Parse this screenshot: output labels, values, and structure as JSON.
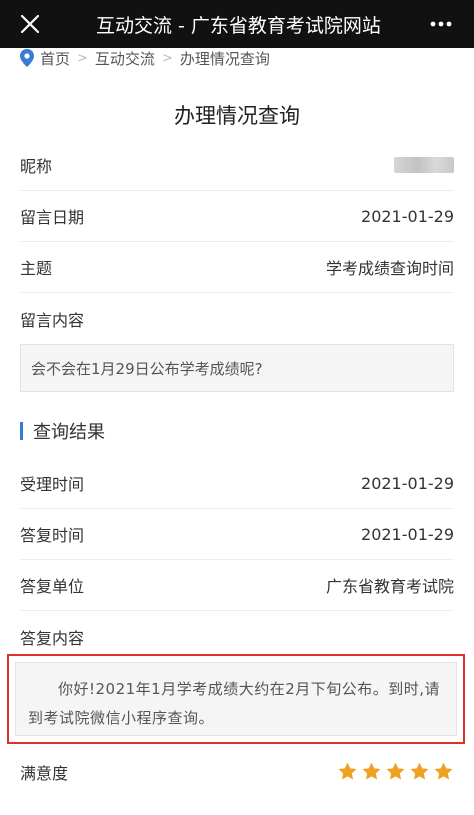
{
  "topbar": {
    "title": "互动交流 - 广东省教育考试院网站"
  },
  "breadcrumb": [
    "首页",
    "互动交流",
    "办理情况查询"
  ],
  "page_title": "办理情况查询",
  "fields": {
    "nickname_label": "昵称",
    "date_label": "留言日期",
    "date_value": "2021-01-29",
    "subject_label": "主题",
    "subject_value": "学考成绩查询时间",
    "content_label": "留言内容",
    "content_value": "会不会在1月29日公布学考成绩呢?"
  },
  "result": {
    "section_title": "查询结果",
    "accept_time_label": "受理时间",
    "accept_time_value": "2021-01-29",
    "reply_time_label": "答复时间",
    "reply_time_value": "2021-01-29",
    "reply_unit_label": "答复单位",
    "reply_unit_value": "广东省教育考试院",
    "reply_content_label": "答复内容",
    "reply_content_value": "你好!2021年1月学考成绩大约在2月下旬公布。到时,请到考试院微信小程序查询。"
  },
  "satisfaction": {
    "label": "满意度",
    "rating": 5,
    "max": 5,
    "star_color": "#f0a020"
  },
  "colors": {
    "accent": "#3a7bd5",
    "highlight_border": "#e0302b",
    "topbar": "#111111"
  }
}
